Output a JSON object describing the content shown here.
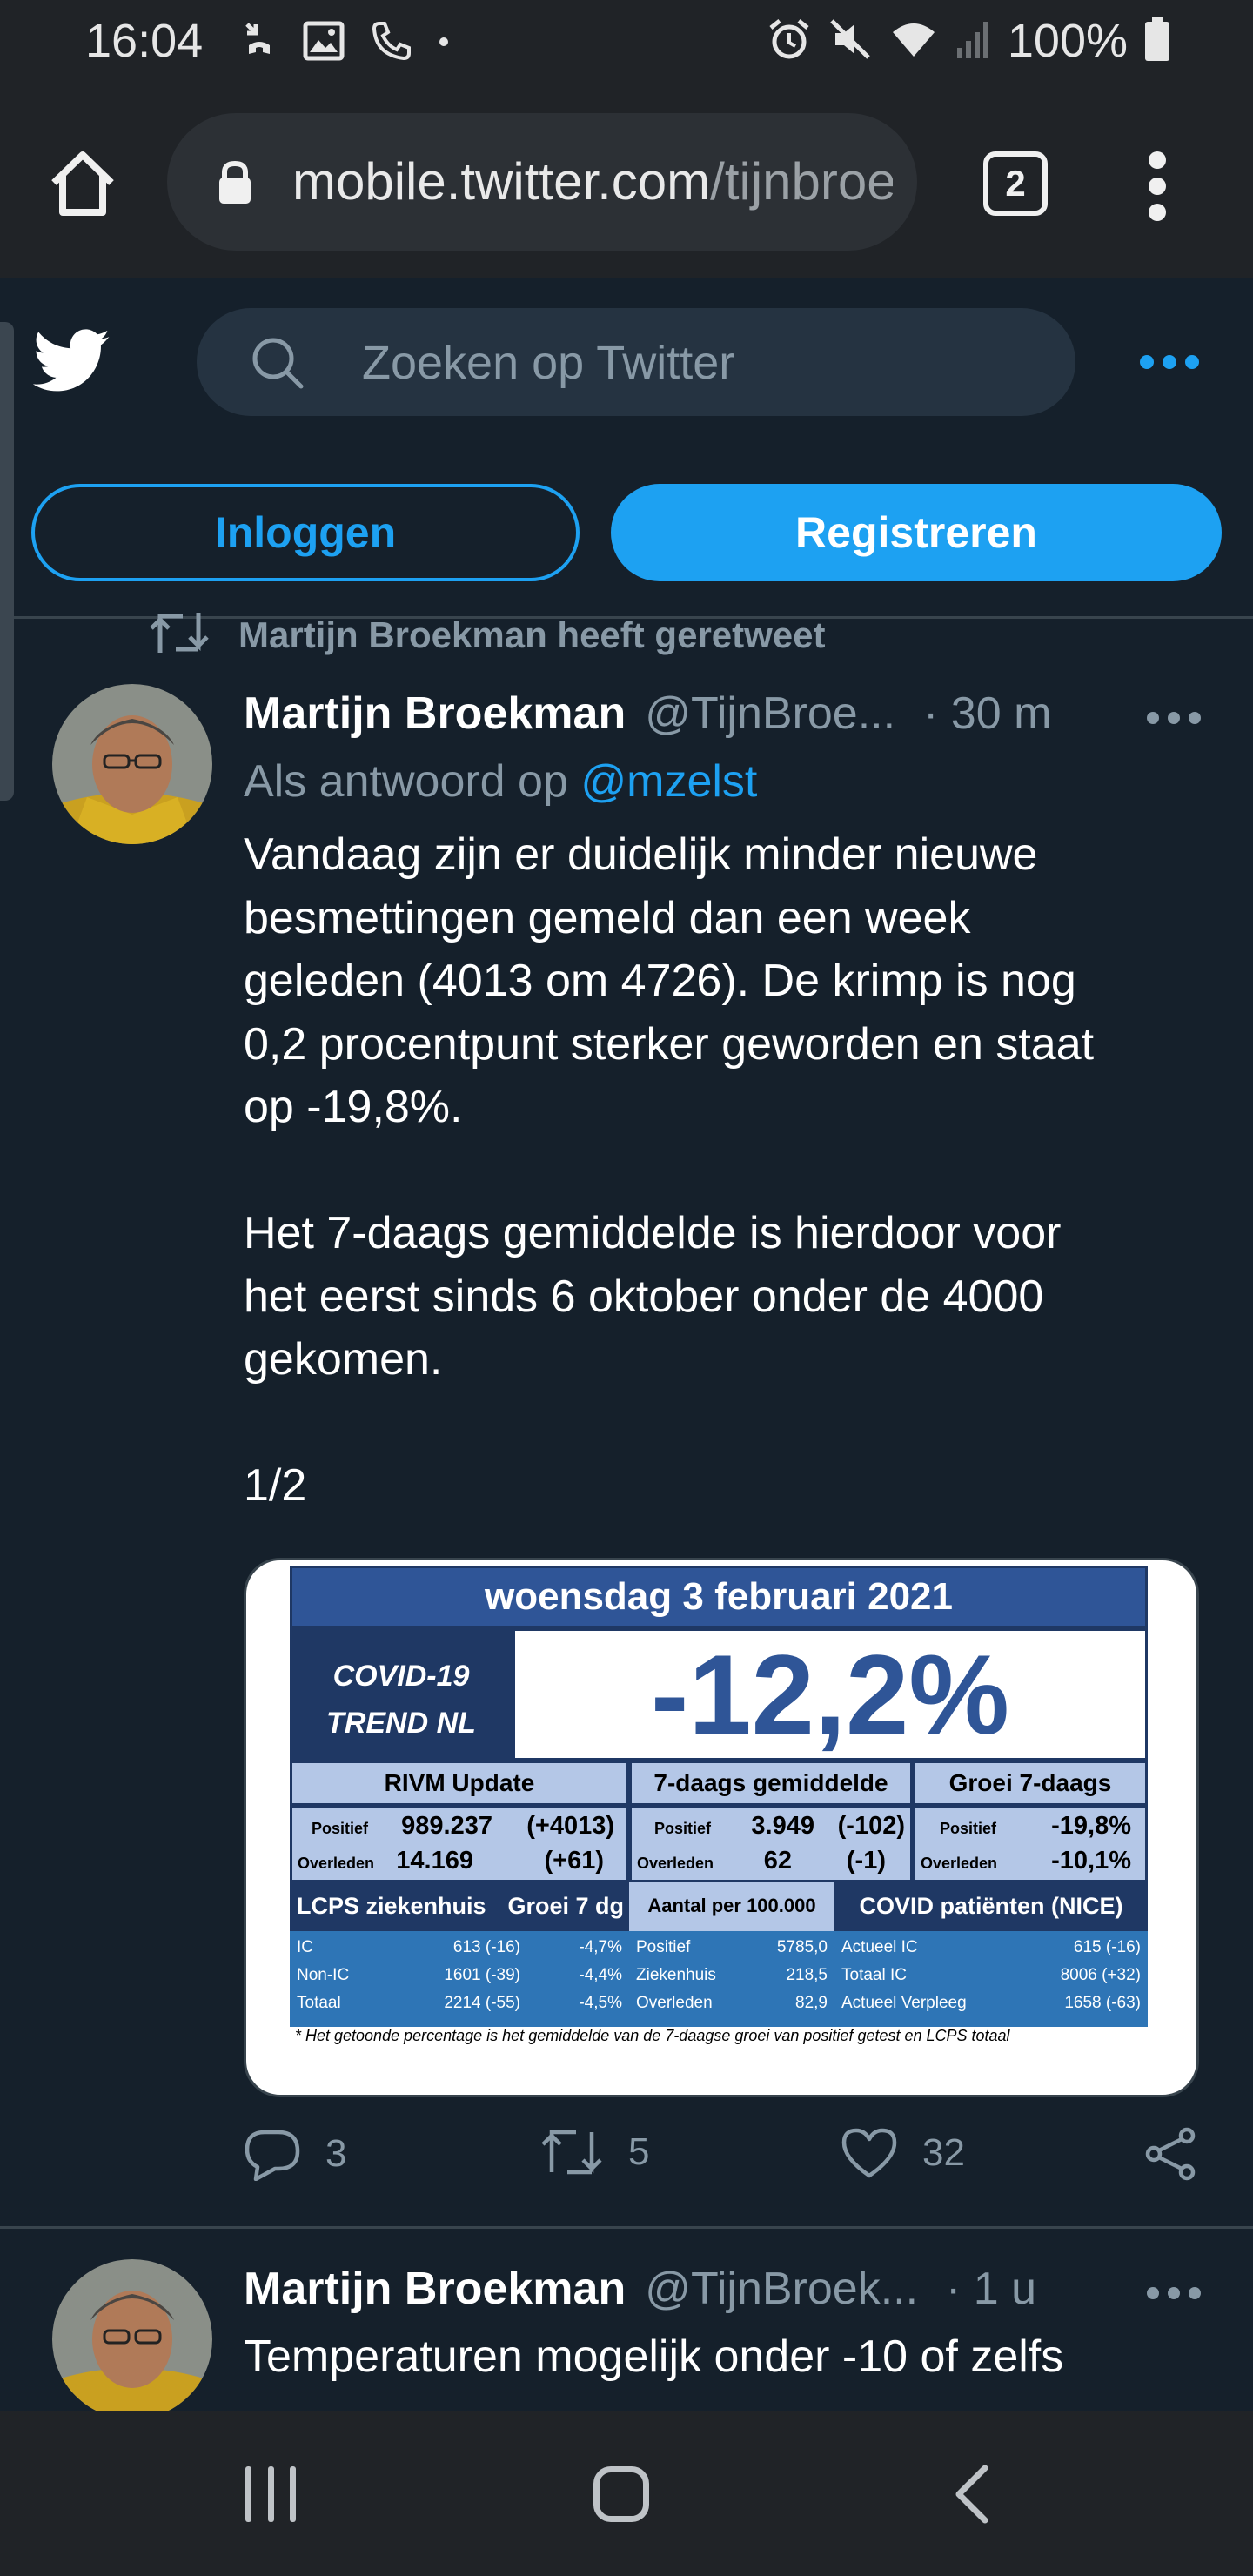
{
  "status_bar": {
    "time": "16:04",
    "battery": "100%",
    "icons": [
      "missed-call-icon",
      "gallery-icon",
      "wifi-call-icon",
      "dot-icon",
      "alarm-icon",
      "mute-icon",
      "wifi-icon",
      "signal-icon",
      "battery-icon"
    ]
  },
  "browser": {
    "url_host": "mobile.twitter.com",
    "url_path": "/tijnbroe",
    "tab_count": "2"
  },
  "twitter": {
    "search_placeholder": "Zoeken op Twitter",
    "login_label": "Inloggen",
    "register_label": "Registreren",
    "accent_color": "#1da1f2"
  },
  "tweets": [
    {
      "retweet_label": "Martijn Broekman heeft geretweet",
      "name": "Martijn Broekman",
      "handle": "@TijnBroe...",
      "time": "· 30 m",
      "reply_prefix": "Als antwoord op ",
      "reply_mention": "@mzelst",
      "text": "Vandaag zijn er duidelijk minder nieuwe\nbesmettingen gemeld dan een week\ngeleden (4013 om 4726). De krimp is nog\n0,2 procentpunt sterker geworden en staat\nop -19,8%.\n\nHet 7-daags gemiddelde is hierdoor voor\nhet eerst sinds 6 oktober onder de 4000\ngekomen.\n\n1/2",
      "media": {
        "title": "woensdag 3 februari 2021",
        "covid_line1": "COVID-19",
        "covid_line2": "TREND NL",
        "trend_pct": "-12,2%",
        "col_headers": [
          "RIVM Update",
          "7-daags gemiddelde",
          "Groei 7-daags"
        ],
        "label_positief": "Positief",
        "label_overleden": "Overleden",
        "rivm_pos": "989.237",
        "rivm_pos_delta": "(+4013)",
        "rivm_over": "14.169",
        "rivm_over_delta": "(+61)",
        "avg_pos": "3.949",
        "avg_pos_delta": "(-102)",
        "avg_over": "62",
        "avg_over_delta": "(-1)",
        "groei_pos": "-19,8%",
        "groei_over": "-10,1%",
        "lcps_header": "LCPS ziekenhuis",
        "lcps_groei_header": "Groei 7 dg",
        "lcps_rows": [
          {
            "label": "IC",
            "value": "613 (-16)",
            "groei": "-4,7%"
          },
          {
            "label": "Non-IC",
            "value": "1601 (-39)",
            "groei": "-4,4%"
          },
          {
            "label": "Totaal",
            "value": "2214 (-55)",
            "groei": "-4,5%"
          }
        ],
        "per100k_header": "Aantal per 100.000",
        "per100k_rows": [
          {
            "label": "Positief",
            "value": "5785,0"
          },
          {
            "label": "Ziekenhuis",
            "value": "218,5"
          },
          {
            "label": "Overleden",
            "value": "82,9"
          }
        ],
        "nice_header": "COVID patiënten (NICE)",
        "nice_rows": [
          {
            "label": "Actueel IC",
            "value": "615 (-16)"
          },
          {
            "label": "Totaal IC",
            "value": "8006 (+32)"
          },
          {
            "label": "Actueel Verpleeg",
            "value": "1658 (-63)"
          }
        ],
        "footnote": "* Het getoonde percentage is het gemiddelde van de 7-daagse groei van positief getest en LCPS totaal"
      },
      "replies": "3",
      "retweets": "5",
      "likes": "32"
    },
    {
      "name": "Martijn Broekman",
      "handle": "@TijnBroek...",
      "time": "· 1 u",
      "text": "Temperaturen mogelijk onder -10 of zelfs"
    }
  ]
}
